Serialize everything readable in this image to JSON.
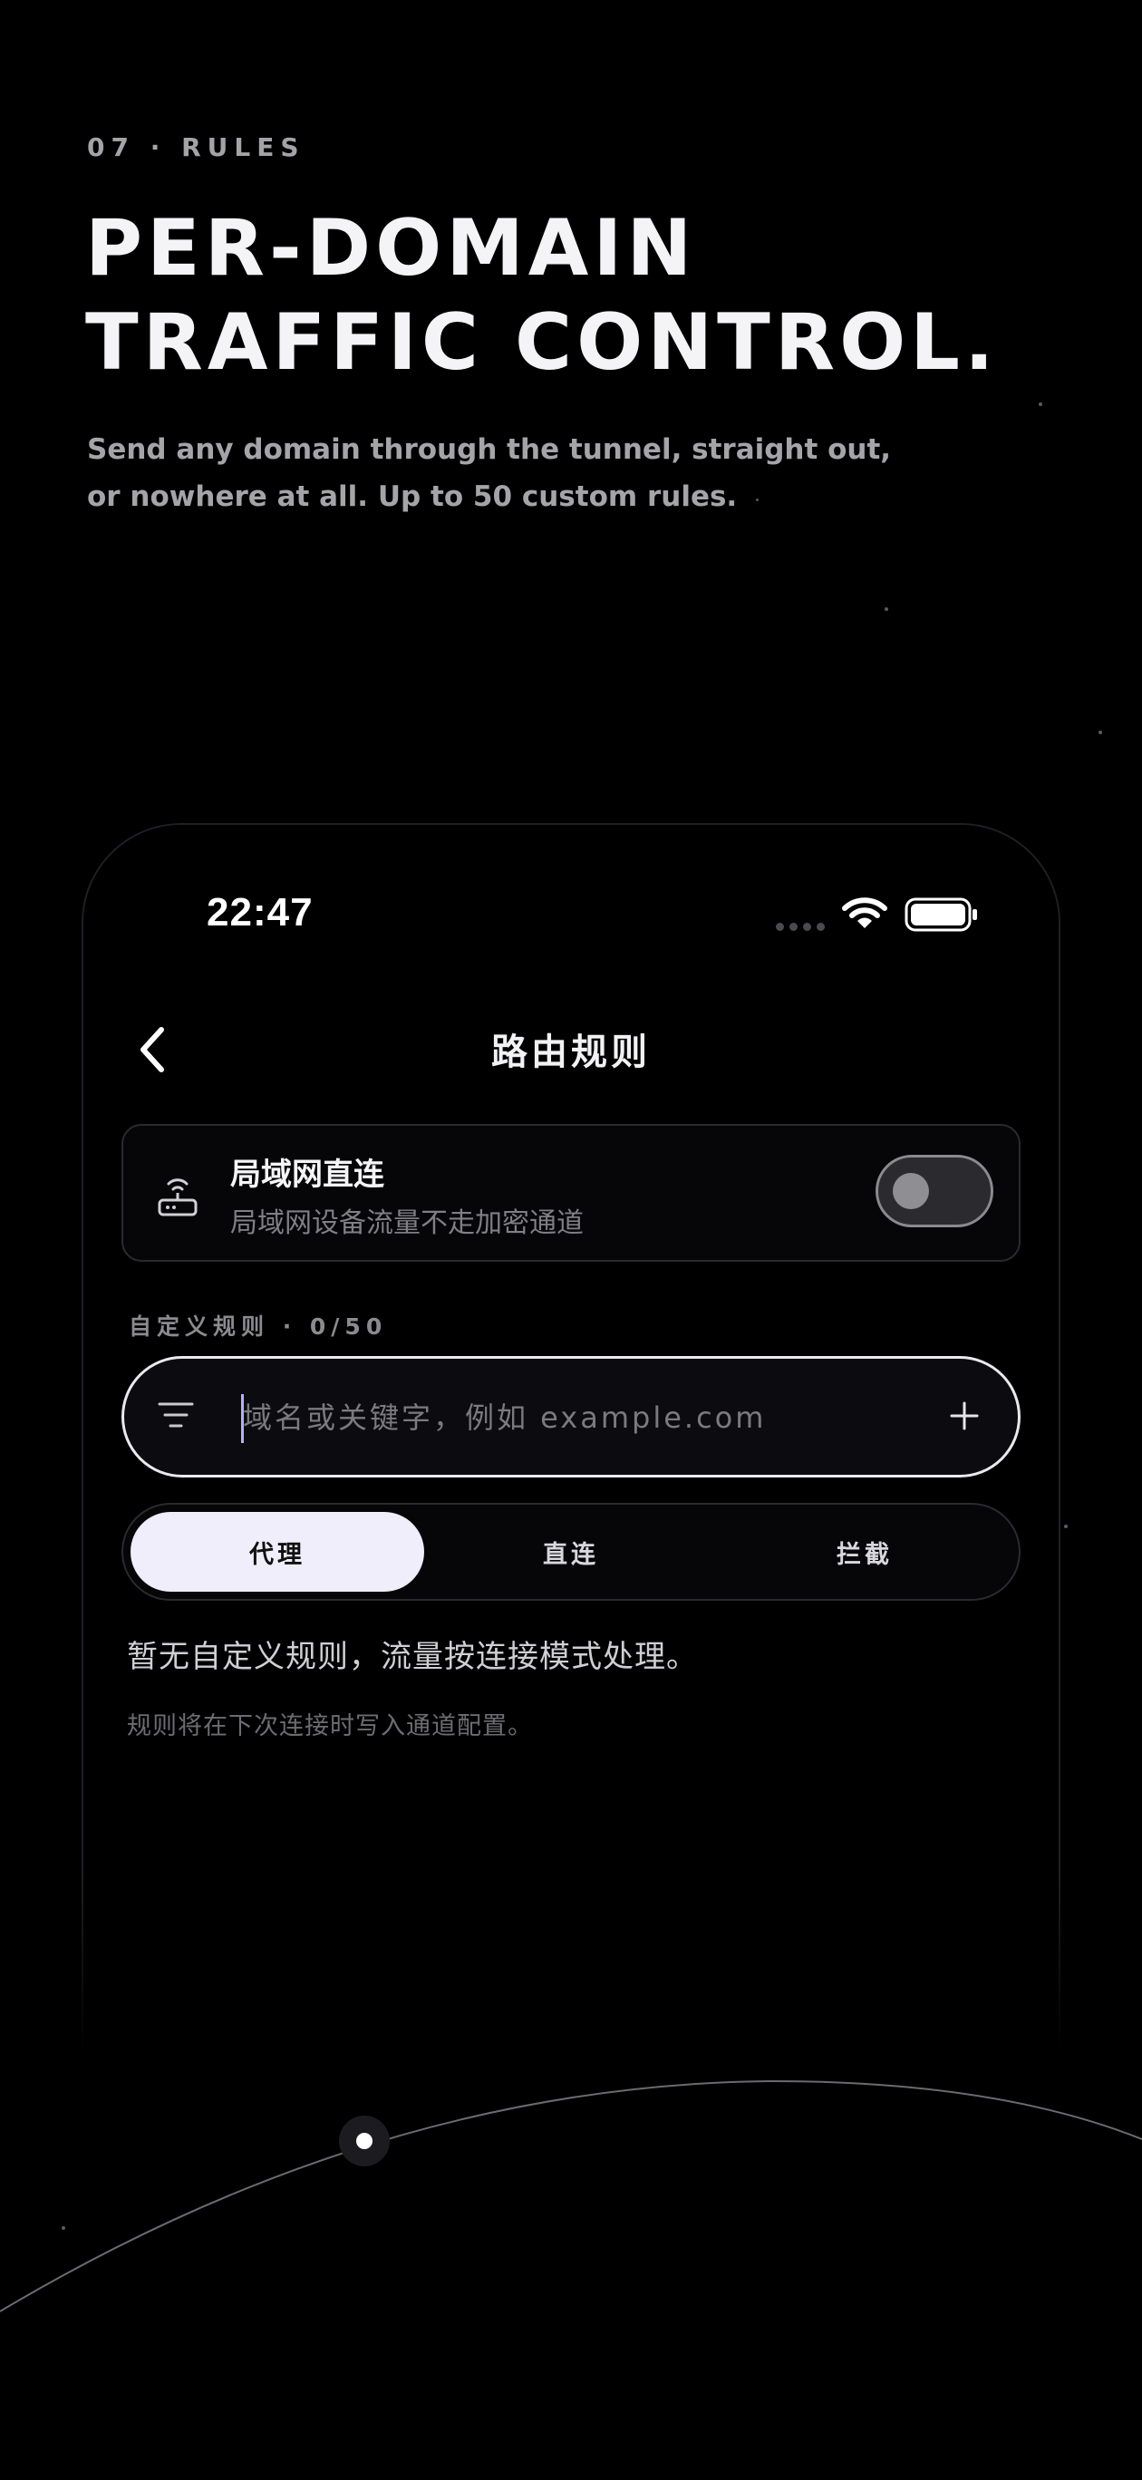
{
  "hero": {
    "eyebrow": "07 · RULES",
    "headline_line1": "PER-DOMAIN",
    "headline_line2": "TRAFFIC CONTROL.",
    "sub_line1": "Send any domain through the tunnel, straight out,",
    "sub_line2": "or nowhere at all. Up to 50 custom rules."
  },
  "status_bar": {
    "time": "22:47",
    "icons": [
      "cellular-signal-icon",
      "wifi-icon",
      "battery-icon"
    ]
  },
  "nav": {
    "back_icon": "chevron-left-icon",
    "title": "路由规则"
  },
  "lan": {
    "icon": "router-icon",
    "title": "局域网直连",
    "subtitle": "局域网设备流量不走加密通道",
    "enabled": false
  },
  "rules": {
    "section_label": "自定义规则 · 0/50",
    "input_value": "",
    "input_placeholder": "域名或关键字，例如 example.com",
    "filter_icon": "filter-icon",
    "add_icon": "plus-icon"
  },
  "modes": {
    "options": [
      "代理",
      "直连",
      "拦截"
    ],
    "selected": "代理"
  },
  "empty_state": {
    "title": "暂无自定义规则，流量按连接模式处理。",
    "subtitle": "规则将在下次连接时写入通道配置。"
  },
  "colors": {
    "background": "#000000",
    "accent_caret": "#b5b0ff",
    "active_segment": "#efeefa",
    "muted_text": "#7f7f85"
  }
}
